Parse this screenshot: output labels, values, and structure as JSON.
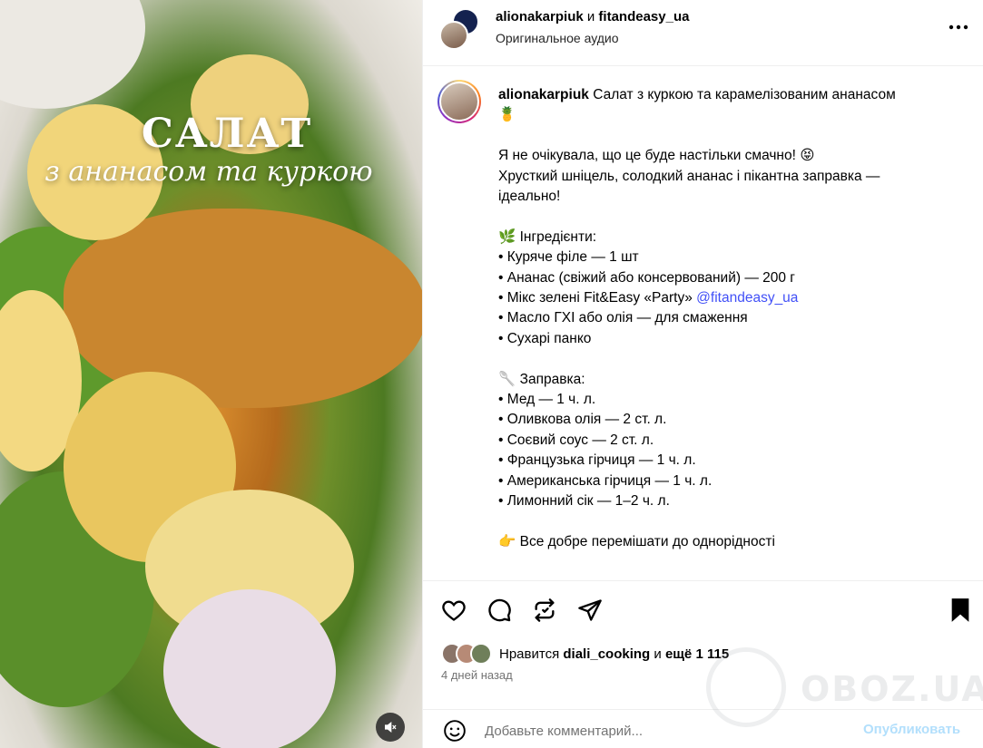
{
  "media": {
    "title_line1": "САЛАТ",
    "title_line2": "з ананасом та куркою"
  },
  "header": {
    "user1": "alionakarpiuk",
    "joiner": " и ",
    "user2": "fitandeasy_ua",
    "subtitle": "Оригинальное аудио"
  },
  "caption": {
    "username": "alionakarpiuk",
    "title": "Салат з куркою та карамелізованим ананасом",
    "title_emoji": "🍍",
    "intro": [
      "Я не очікувала, що це буде настільки смачно! 😝",
      "Хрусткий шніцель, солодкий ананас і пікантна заправка —",
      "ідеально!"
    ],
    "ingredients_heading": "🌿  Інгредієнти:",
    "ingredients": [
      "• Куряче філе — 1 шт",
      "• Ананас (свіжий або консервований) — 200 г",
      "• Мікс зелені Fit&Easy «Party» "
    ],
    "ingredients_mention": "@fitandeasy_ua",
    "ingredients_rest": [
      "• Масло ГХІ або олія — для смаження",
      "• Сухарі панко"
    ],
    "dressing_heading": "🥄  Заправка:",
    "dressing": [
      "• Мед — 1 ч. л.",
      "• Оливкова олія — 2 ст. л.",
      "• Соєвий соус — 2 ст. л.",
      "• Французька гірчиця — 1 ч. л.",
      "• Американська гірчиця — 1 ч. л.",
      "• Лимонний сік — 1–2 ч. л."
    ],
    "mix_line": "👉  Все добре перемішати до однорідності"
  },
  "likes": {
    "prefix": "Нравится ",
    "user": "diali_cooking",
    "middle": " и ",
    "rest": "ещё 1 115"
  },
  "time_ago": "4 дней назад",
  "comment": {
    "placeholder": "Добавьте комментарий...",
    "publish": "Опубликовать"
  },
  "watermark": "OBOZ.UA",
  "colors": {
    "link": "#4150f7",
    "muted": "#737373",
    "publish": "#b2dffc"
  }
}
